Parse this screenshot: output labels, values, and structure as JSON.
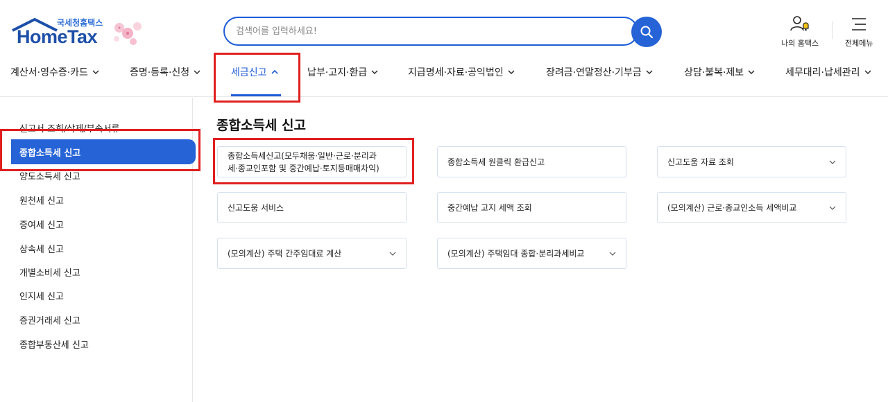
{
  "logo": {
    "sub": "국세청홈택스",
    "main": "HomeTax"
  },
  "search": {
    "placeholder": "검색어를 입력하세요!"
  },
  "util": {
    "my": "나의 홈택스",
    "menu": "전체메뉴"
  },
  "gnb": [
    {
      "label": "계산서·영수증·카드",
      "active": false
    },
    {
      "label": "증명·등록·신청",
      "active": false
    },
    {
      "label": "세금신고",
      "active": true
    },
    {
      "label": "납부·고지·환급",
      "active": false
    },
    {
      "label": "지급명세·자료·공익법인",
      "active": false
    },
    {
      "label": "장려금·연말정산·기부금",
      "active": false
    },
    {
      "label": "상담·불복·제보",
      "active": false
    },
    {
      "label": "세무대리·납세관리",
      "active": false
    }
  ],
  "sidebar": {
    "items": [
      "신고서 조회/삭제/부속서류",
      "종합소득세 신고",
      "양도소득세 신고",
      "원천세 신고",
      "증여세 신고",
      "상속세 신고",
      "개별소비세 신고",
      "인지세 신고",
      "증권거래세 신고",
      "종합부동산세 신고"
    ]
  },
  "main": {
    "title": "종합소득세 신고",
    "cards": [
      {
        "line1": "종합소득세신고(모두채움·일반·근로·분리과",
        "line2": "세·종교인포함 및 중간예납·토지등매매차익)",
        "expand": false
      },
      {
        "line1": "종합소득세 원클릭 환급신고",
        "line2": "",
        "expand": false
      },
      {
        "line1": "신고도움 자료 조회",
        "line2": "",
        "expand": true
      },
      {
        "line1": "신고도움 서비스",
        "line2": "",
        "expand": false
      },
      {
        "line1": "중간예납 고지 세액 조회",
        "line2": "",
        "expand": false
      },
      {
        "line1": "(모의계산) 근로·종교인소득 세액비교",
        "line2": "",
        "expand": true
      },
      {
        "line1": "(모의계산) 주택 간주임대료 계산",
        "line2": "",
        "expand": true
      },
      {
        "line1": "(모의계산) 주택임대 종합·분리과세비교",
        "line2": "",
        "expand": true
      }
    ]
  },
  "colors": {
    "accent": "#2563d6",
    "highlight": "#e01f1f"
  }
}
